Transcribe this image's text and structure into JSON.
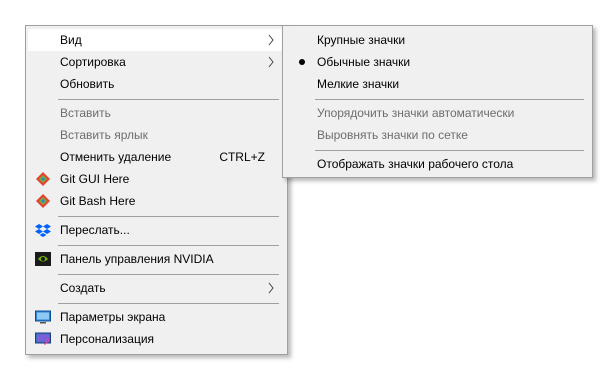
{
  "main_menu": {
    "items": [
      {
        "label": "Вид",
        "submenu": true
      },
      {
        "label": "Сортировка",
        "submenu": true
      },
      {
        "label": "Обновить"
      },
      {
        "label": "Вставить",
        "disabled": true
      },
      {
        "label": "Вставить ярлык",
        "disabled": true
      },
      {
        "label": "Отменить удаление",
        "shortcut": "CTRL+Z"
      },
      {
        "label": "Git GUI Here",
        "icon": "git-icon"
      },
      {
        "label": "Git Bash Here",
        "icon": "git-icon"
      },
      {
        "label": "Переслать...",
        "icon": "dropbox-icon"
      },
      {
        "label": "Панель управления NVIDIA",
        "icon": "nvidia-icon"
      },
      {
        "label": "Создать",
        "submenu": true
      },
      {
        "label": "Параметры экрана",
        "icon": "display-settings-icon"
      },
      {
        "label": "Персонализация",
        "icon": "personalization-icon"
      }
    ]
  },
  "view_submenu": {
    "items": [
      {
        "label": "Крупные значки"
      },
      {
        "label": "Обычные значки",
        "checked": true
      },
      {
        "label": "Мелкие значки"
      },
      {
        "label": "Упорядочить значки автоматически",
        "disabled": true
      },
      {
        "label": "Выровнять значки по сетке",
        "disabled": true
      },
      {
        "label": "Отображать значки рабочего стола"
      }
    ]
  },
  "colors": {
    "menu_bg": "#f0f0f0",
    "hover_bg": "#ffffff",
    "disabled_text": "#6d6d6d",
    "separator": "#a0a0a0",
    "git_red": "#e8412d",
    "dropbox_blue": "#0061fe",
    "nvidia_green": "#76b900"
  }
}
